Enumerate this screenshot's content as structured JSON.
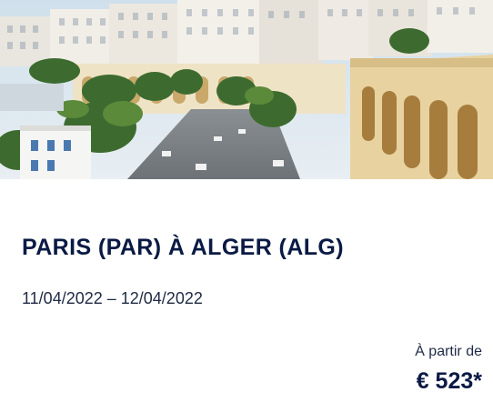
{
  "offer": {
    "title": "PARIS (PAR) À ALGER (ALG)",
    "dates": "11/04/2022 – 12/04/2022",
    "price_label": "À partir de",
    "price": "€ 523*"
  },
  "colors": {
    "title": "#0a1a44",
    "text": "#1f2a44"
  }
}
